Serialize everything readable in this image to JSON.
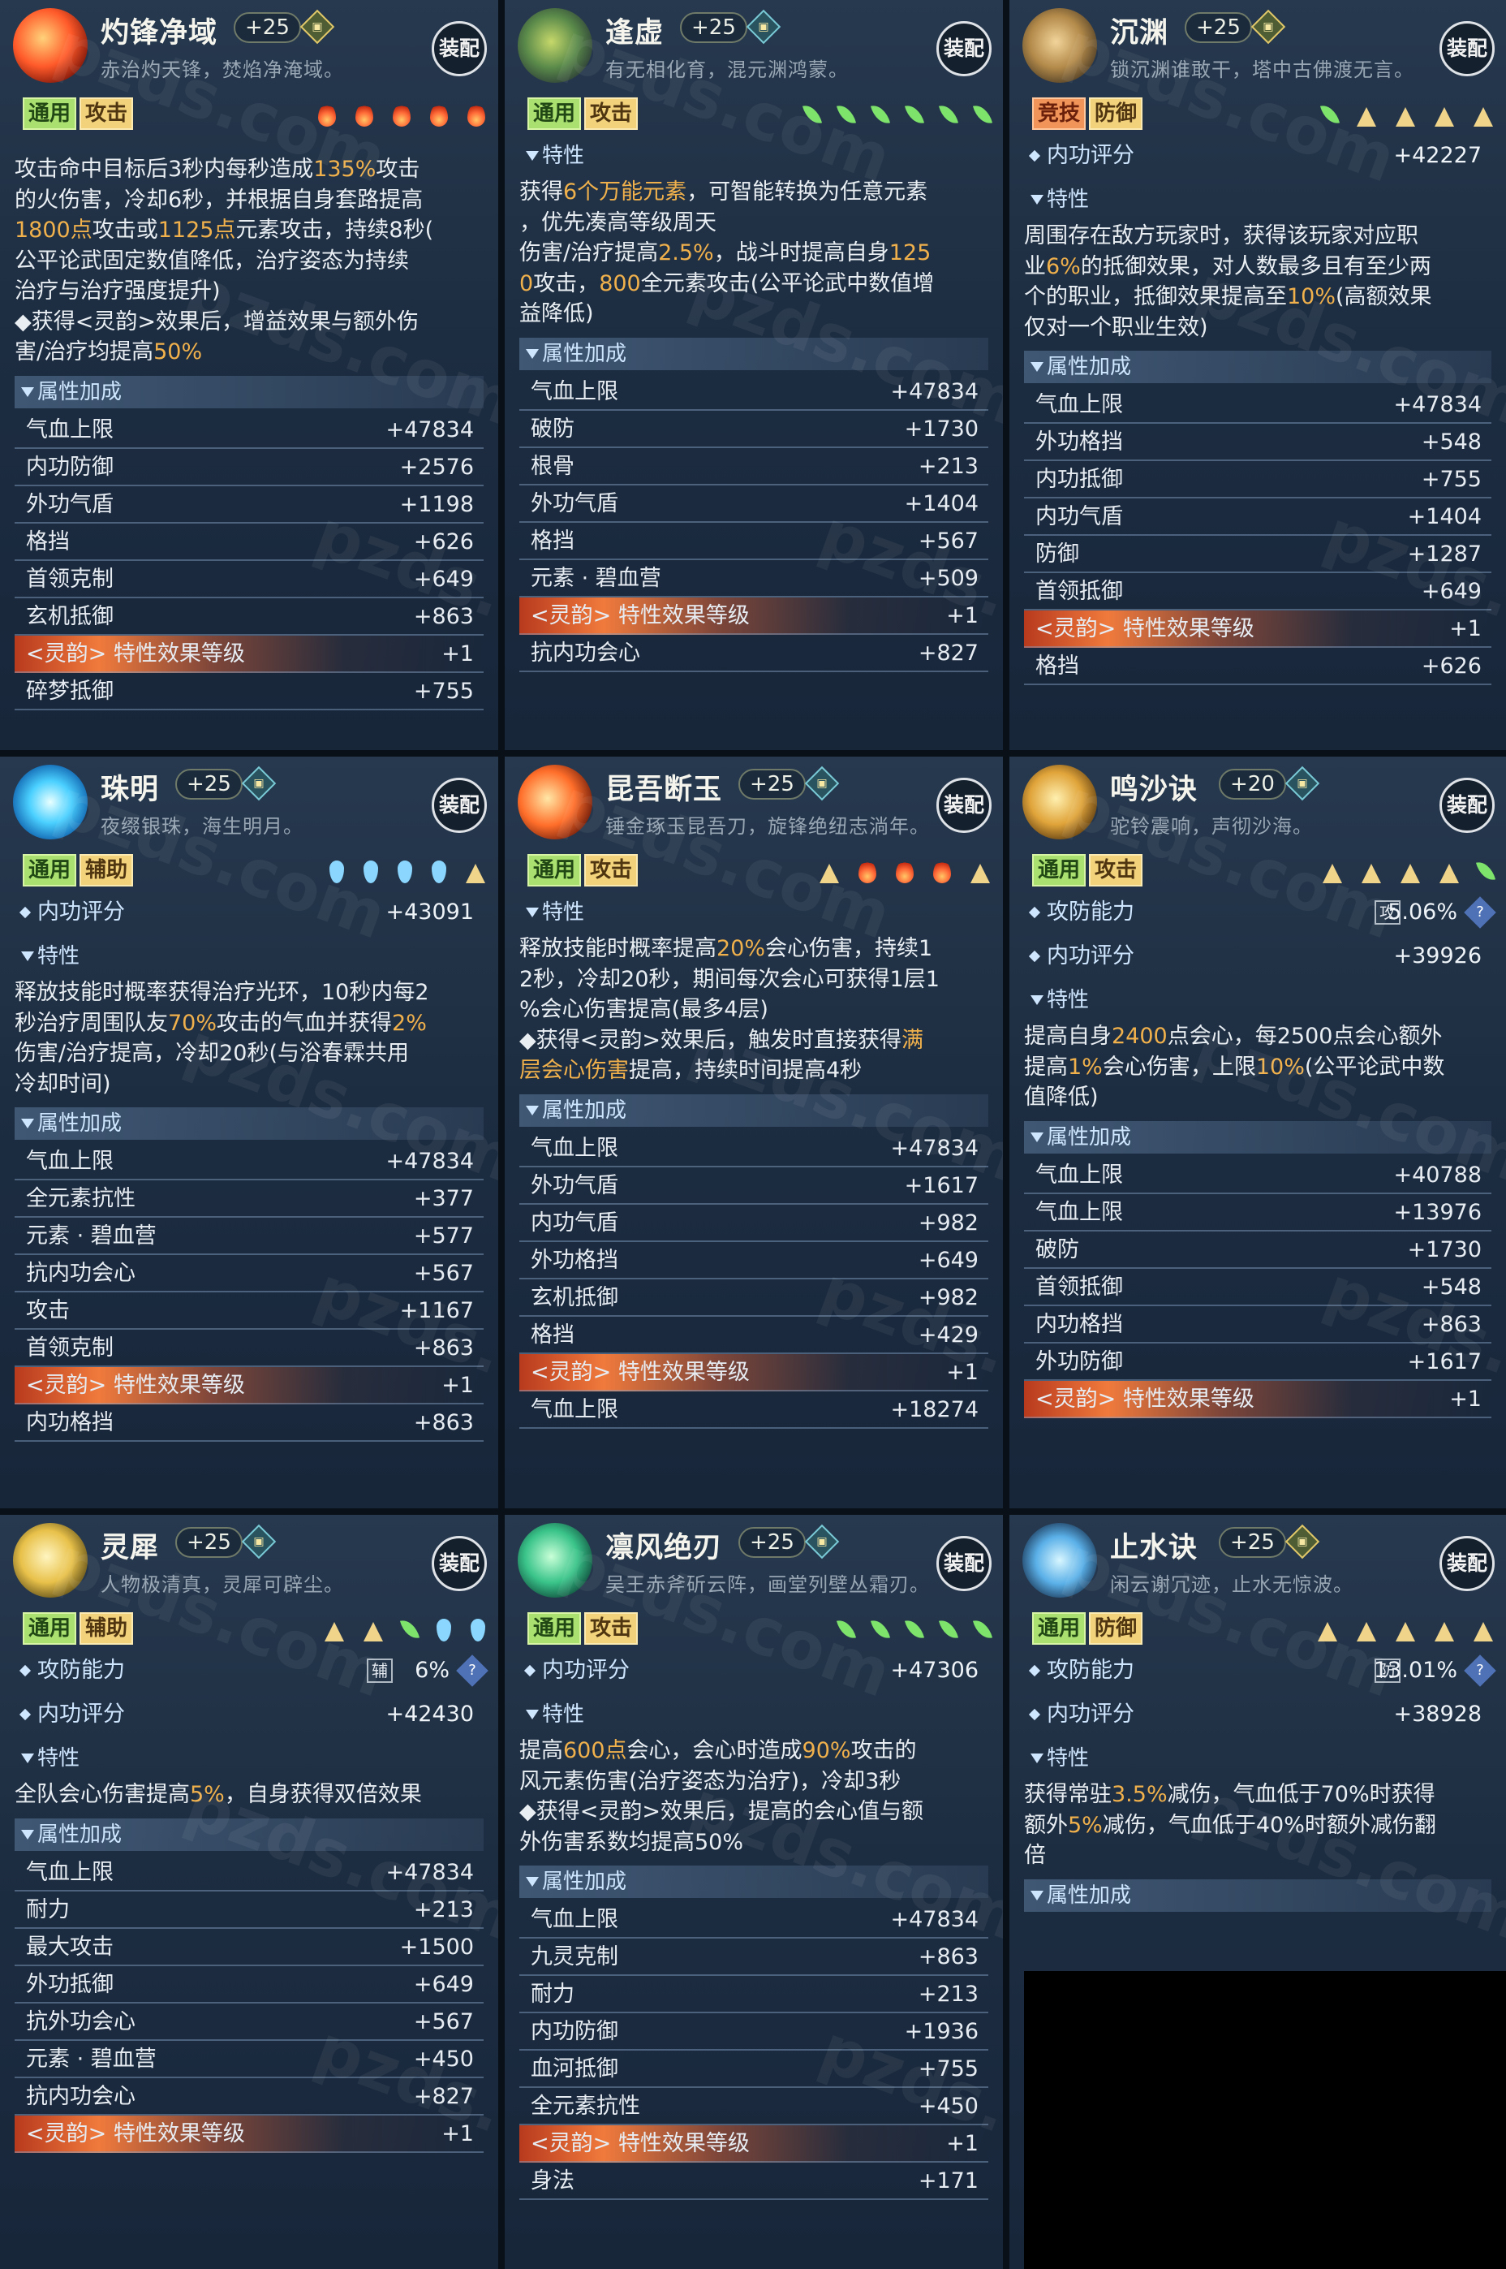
{
  "cards": [
    {
      "name": "灼锋净域",
      "level": "+25",
      "motto": "赤治灼天锋，焚焰净淹域。",
      "equip": "装配",
      "tags": [
        "通用",
        "攻击"
      ],
      "tag_styles": [
        "green",
        "yellow"
      ],
      "elements": [
        "fire",
        "fire",
        "fire",
        "fire",
        "fire"
      ],
      "desc_lines": [
        [
          {
            "t": "攻击命中目标后3秒内每秒造成"
          },
          {
            "t": "135%",
            "h": 1
          },
          {
            "t": "攻击"
          }
        ],
        [
          {
            "t": "的火伤害，冷却6秒，并根据自身套路提高"
          }
        ],
        [
          {
            "t": "1800点",
            "h": 1
          },
          {
            "t": "攻击或"
          },
          {
            "t": "1125点",
            "h": 1
          },
          {
            "t": "元素攻击，持续8秒("
          }
        ],
        [
          {
            "t": "公平论武固定数值降低，治疗姿态为持续"
          }
        ],
        [
          {
            "t": "治疗与治疗强度提升)"
          }
        ],
        [
          {
            "t": "◆获得<灵韵>效果后，增益效果与额外伤"
          }
        ],
        [
          {
            "t": "害/治疗均提高"
          },
          {
            "t": "50%",
            "h": 1
          }
        ]
      ],
      "attr_header": "属性加成",
      "attrs": [
        [
          "气血上限",
          "+47834"
        ],
        [
          "内功防御",
          "+2576"
        ],
        [
          "外功气盾",
          "+1198"
        ],
        [
          "格挡",
          "+626"
        ],
        [
          "首领克制",
          "+649"
        ],
        [
          "玄机抵御",
          "+863"
        ],
        [
          "<灵韵> 特性效果等级",
          "+1"
        ],
        [
          "碎梦抵御",
          "+755"
        ]
      ]
    },
    {
      "name": "逢虚",
      "level": "+25",
      "motto": "有无相化育，混元渊鸿蒙。",
      "equip": "装配",
      "tags": [
        "通用",
        "攻击"
      ],
      "tag_styles": [
        "green",
        "yellow"
      ],
      "elements": [
        "leaf",
        "leaf",
        "leaf",
        "leaf",
        "leaf",
        "leaf"
      ],
      "trait_header": "特性",
      "desc_lines": [
        [
          {
            "t": "获得"
          },
          {
            "t": "6个万能元素",
            "h": 1
          },
          {
            "t": "，可智能转换为任意元素"
          }
        ],
        [
          {
            "t": "，优先凑高等级周天"
          }
        ],
        [
          {
            "t": "伤害/治疗提高"
          },
          {
            "t": "2.5%",
            "h": 1
          },
          {
            "t": "，战斗时提高自身"
          },
          {
            "t": "125",
            "h": 1
          }
        ],
        [
          {
            "t": "0",
            "h": 1
          },
          {
            "t": "攻击，"
          },
          {
            "t": "800",
            "h": 1
          },
          {
            "t": "全元素攻击(公平论武中数值增"
          }
        ],
        [
          {
            "t": "益降低)"
          }
        ]
      ],
      "attr_header": "属性加成",
      "attrs": [
        [
          "气血上限",
          "+47834"
        ],
        [
          "破防",
          "+1730"
        ],
        [
          "根骨",
          "+213"
        ],
        [
          "外功气盾",
          "+1404"
        ],
        [
          "格挡",
          "+567"
        ],
        [
          "元素 · 碧血营",
          "+509"
        ],
        [
          "<灵韵> 特性效果等级",
          "+1"
        ],
        [
          "抗内功会心",
          "+827"
        ]
      ]
    },
    {
      "name": "沉渊",
      "level": "+25",
      "motto": "锁沉渊谁敢干，塔中古佛渡无言。",
      "equip": "装配",
      "tags": [
        "竞技",
        "防御"
      ],
      "tag_styles": [
        "orange",
        "yellow"
      ],
      "elements": [
        "leaf",
        "mount",
        "mount",
        "mount",
        "mount"
      ],
      "score_label": "内功评分",
      "score_value": "+42227",
      "trait_header": "特性",
      "desc_lines": [
        [
          {
            "t": "周围存在敌方玩家时，获得该玩家对应职"
          }
        ],
        [
          {
            "t": "业"
          },
          {
            "t": "6%",
            "h": 1
          },
          {
            "t": "的抵御效果，对人数最多且有至少两"
          }
        ],
        [
          {
            "t": "个的职业，抵御效果提高至"
          },
          {
            "t": "10%",
            "h": 1
          },
          {
            "t": "(高额效果"
          }
        ],
        [
          {
            "t": "仅对一个职业生效)"
          }
        ]
      ],
      "attr_header": "属性加成",
      "attrs": [
        [
          "气血上限",
          "+47834"
        ],
        [
          "外功格挡",
          "+548"
        ],
        [
          "内功抵御",
          "+755"
        ],
        [
          "内功气盾",
          "+1404"
        ],
        [
          "防御",
          "+1287"
        ],
        [
          "首领抵御",
          "+649"
        ],
        [
          "<灵韵> 特性效果等级",
          "+1"
        ],
        [
          "格挡",
          "+626"
        ]
      ]
    },
    {
      "name": "珠明",
      "level": "+25",
      "motto": "夜缀银珠，海生明月。",
      "equip": "装配",
      "tags": [
        "通用",
        "辅助"
      ],
      "tag_styles": [
        "green",
        "yellow"
      ],
      "elements": [
        "water",
        "water",
        "water",
        "water",
        "mount"
      ],
      "score_label": "内功评分",
      "score_value": "+43091",
      "trait_header": "特性",
      "desc_lines": [
        [
          {
            "t": "释放技能时概率获得治疗光环，10秒内每2"
          }
        ],
        [
          {
            "t": "秒治疗周围队友"
          },
          {
            "t": "70%",
            "h": 1
          },
          {
            "t": "攻击的气血并获得"
          },
          {
            "t": "2%",
            "h": 1
          }
        ],
        [
          {
            "t": "伤害/治疗提高，冷却20秒(与浴春霖共用"
          }
        ],
        [
          {
            "t": "冷却时间)"
          }
        ]
      ],
      "attr_header": "属性加成",
      "attrs": [
        [
          "气血上限",
          "+47834"
        ],
        [
          "全元素抗性",
          "+377"
        ],
        [
          "元素 · 碧血营",
          "+577"
        ],
        [
          "抗内功会心",
          "+567"
        ],
        [
          "攻击",
          "+1167"
        ],
        [
          "首领克制",
          "+863"
        ],
        [
          "<灵韵> 特性效果等级",
          "+1"
        ],
        [
          "内功格挡",
          "+863"
        ]
      ]
    },
    {
      "name": "昆吾断玉",
      "level": "+25",
      "motto": "锤金琢玉昆吾刀，旋锋绝纽志淌年。",
      "equip": "装配",
      "tags": [
        "通用",
        "攻击"
      ],
      "tag_styles": [
        "green",
        "yellow"
      ],
      "elements": [
        "mount",
        "fire",
        "fire",
        "fire",
        "mount"
      ],
      "trait_header": "特性",
      "desc_lines": [
        [
          {
            "t": "释放技能时概率提高"
          },
          {
            "t": "20%",
            "h": 1
          },
          {
            "t": "会心伤害，持续1"
          }
        ],
        [
          {
            "t": "2秒，冷却20秒，期间每次会心可获得1层1"
          }
        ],
        [
          {
            "t": "%会心伤害提高(最多4层)"
          }
        ],
        [
          {
            "t": "◆获得<灵韵>效果后，触发时直接获得"
          },
          {
            "t": "满",
            "h": 1
          }
        ],
        [
          {
            "t": "层会心伤害",
            "h": 1
          },
          {
            "t": "提高，持续时间提高4秒"
          }
        ]
      ],
      "attr_header": "属性加成",
      "attrs": [
        [
          "气血上限",
          "+47834"
        ],
        [
          "外功气盾",
          "+1617"
        ],
        [
          "内功气盾",
          "+982"
        ],
        [
          "外功格挡",
          "+649"
        ],
        [
          "玄机抵御",
          "+982"
        ],
        [
          "格挡",
          "+429"
        ],
        [
          "<灵韵> 特性效果等级",
          "+1"
        ],
        [
          "气血上限",
          "+18274"
        ]
      ]
    },
    {
      "name": "鸣沙诀",
      "level": "+20",
      "motto": "驼铃震响，声彻沙海。",
      "equip": "装配",
      "tags": [
        "通用",
        "攻击"
      ],
      "tag_styles": [
        "green",
        "yellow"
      ],
      "elements": [
        "mount",
        "mount",
        "mount",
        "mount",
        "leaf"
      ],
      "ability_label": "攻防能力",
      "ability_badge": "攻",
      "ability_value": "5.06%",
      "help_icon": "?",
      "score_label": "内功评分",
      "score_value": "+39926",
      "trait_header": "特性",
      "desc_lines": [
        [
          {
            "t": "提高自身"
          },
          {
            "t": "2400",
            "h": 1
          },
          {
            "t": "点会心，每2500点会心额外"
          }
        ],
        [
          {
            "t": "提高"
          },
          {
            "t": "1%",
            "h": 1
          },
          {
            "t": "会心伤害，上限"
          },
          {
            "t": "10%",
            "h": 1
          },
          {
            "t": "(公平论武中数"
          }
        ],
        [
          {
            "t": "值降低)"
          }
        ]
      ],
      "attr_header": "属性加成",
      "attrs": [
        [
          "气血上限",
          "+40788"
        ],
        [
          "气血上限",
          "+13976"
        ],
        [
          "破防",
          "+1730"
        ],
        [
          "首领抵御",
          "+548"
        ],
        [
          "内功格挡",
          "+863"
        ],
        [
          "外功防御",
          "+1617"
        ],
        [
          "<灵韵> 特性效果等级",
          "+1"
        ]
      ]
    },
    {
      "name": "灵犀",
      "level": "+25",
      "motto": "人物极清真，灵犀可辟尘。",
      "equip": "装配",
      "tags": [
        "通用",
        "辅助"
      ],
      "tag_styles": [
        "green",
        "yellow"
      ],
      "elements": [
        "mount",
        "mount",
        "leaf",
        "water",
        "water"
      ],
      "ability_label": "攻防能力",
      "ability_badge": "辅",
      "ability_value": "6%",
      "help_icon": "?",
      "score_label": "内功评分",
      "score_value": "+42430",
      "trait_header": "特性",
      "desc_lines": [
        [
          {
            "t": "全队会心伤害提高"
          },
          {
            "t": "5%",
            "h": 1
          },
          {
            "t": "，自身获得双倍效果"
          }
        ]
      ],
      "attr_header": "属性加成",
      "attrs": [
        [
          "气血上限",
          "+47834"
        ],
        [
          "耐力",
          "+213"
        ],
        [
          "最大攻击",
          "+1500"
        ],
        [
          "外功抵御",
          "+649"
        ],
        [
          "抗外功会心",
          "+567"
        ],
        [
          "元素 · 碧血营",
          "+450"
        ],
        [
          "抗内功会心",
          "+827"
        ],
        [
          "<灵韵> 特性效果等级",
          "+1"
        ]
      ]
    },
    {
      "name": "凛风绝刃",
      "level": "+25",
      "motto": "吴王赤斧斫云阵，画堂列壁丛霜刃。",
      "equip": "装配",
      "tags": [
        "通用",
        "攻击"
      ],
      "tag_styles": [
        "green",
        "yellow"
      ],
      "elements": [
        "leaf",
        "leaf",
        "leaf",
        "leaf",
        "leaf"
      ],
      "score_label": "内功评分",
      "score_value": "+47306",
      "trait_header": "特性",
      "desc_lines": [
        [
          {
            "t": "提高"
          },
          {
            "t": "600点",
            "h": 1
          },
          {
            "t": "会心，会心时造成"
          },
          {
            "t": "90%",
            "h": 1
          },
          {
            "t": "攻击的"
          }
        ],
        [
          {
            "t": "风元素伤害(治疗姿态为治疗)，冷却3秒"
          }
        ],
        [
          {
            "t": "◆获得<灵韵>效果后，提高的会心值与额"
          }
        ],
        [
          {
            "t": "外伤害系数均提高50%"
          }
        ]
      ],
      "attr_header": "属性加成",
      "attrs": [
        [
          "气血上限",
          "+47834"
        ],
        [
          "九灵克制",
          "+863"
        ],
        [
          "耐力",
          "+213"
        ],
        [
          "内功防御",
          "+1936"
        ],
        [
          "血河抵御",
          "+755"
        ],
        [
          "全元素抗性",
          "+450"
        ],
        [
          "<灵韵> 特性效果等级",
          "+1"
        ],
        [
          "身法",
          "+171"
        ]
      ]
    },
    {
      "name": "止水诀",
      "level": "+25",
      "motto": "闲云谢冗迹，止水无惊波。",
      "equip": "装配",
      "tags": [
        "通用",
        "防御"
      ],
      "tag_styles": [
        "green",
        "yellow"
      ],
      "elements": [
        "mount",
        "mount",
        "mount",
        "mount",
        "mount"
      ],
      "ability_label": "攻防能力",
      "ability_badge": "防",
      "ability_value": "13.01%",
      "help_icon": "?",
      "score_label": "内功评分",
      "score_value": "+38928",
      "trait_header": "特性",
      "desc_lines": [
        [
          {
            "t": "获得常驻"
          },
          {
            "t": "3.5%",
            "h": 1
          },
          {
            "t": "减伤，气血低于70%时获得"
          }
        ],
        [
          {
            "t": "额外"
          },
          {
            "t": "5%",
            "h": 1
          },
          {
            "t": "减伤，气血低于40%时额外减伤翻"
          }
        ],
        [
          {
            "t": "倍"
          }
        ]
      ],
      "attr_header": "属性加成",
      "attrs": []
    }
  ],
  "watermark": "pzds.com"
}
